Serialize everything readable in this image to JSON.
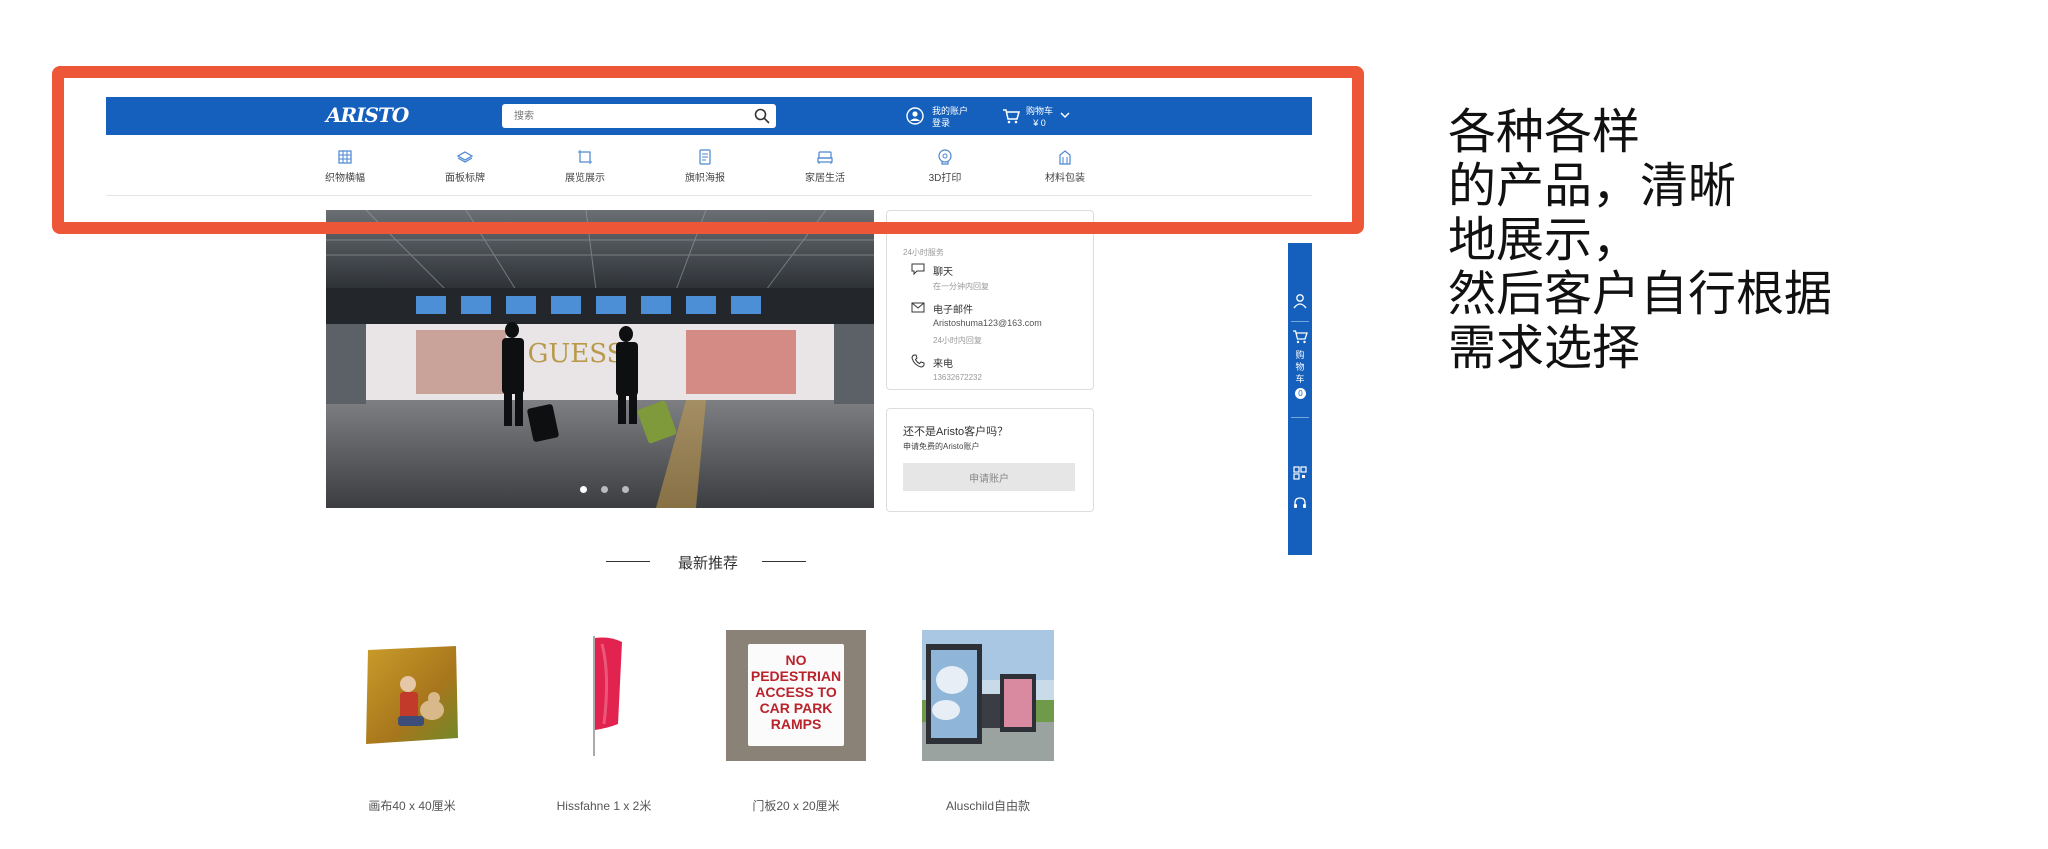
{
  "header": {
    "logo": "ARISTO",
    "search_placeholder": "搜索",
    "account_line1": "我的账户",
    "account_line2": "登录",
    "cart_line1": "购物车",
    "cart_line2": "¥ 0"
  },
  "categories": [
    {
      "label": "织物横幅",
      "icon": "fabric-icon"
    },
    {
      "label": "面板标牌",
      "icon": "panel-icon"
    },
    {
      "label": "展览展示",
      "icon": "frame-icon"
    },
    {
      "label": "旗帜海报",
      "icon": "poster-icon"
    },
    {
      "label": "家居生活",
      "icon": "bed-icon"
    },
    {
      "label": "3D打印",
      "icon": "3d-icon"
    },
    {
      "label": "材料包装",
      "icon": "package-icon"
    }
  ],
  "banner": {
    "slides": 3,
    "active_slide": 1
  },
  "contact": {
    "service_hours": "24小时服务",
    "chat_label": "聊天",
    "chat_note": "在一分钟内回复",
    "email_label": "电子邮件",
    "email_value": "Aristoshuma123@163.com",
    "email_note": "24小时内回复",
    "phone_label": "来电",
    "phone_value": "13632672232"
  },
  "signup": {
    "question": "还不是Aristo客户吗？",
    "sub": "申请免费的Aristo账户",
    "button": "申请账户"
  },
  "sidebar": {
    "cart_label_1": "购",
    "cart_label_2": "物",
    "cart_label_3": "车",
    "cart_count": "0"
  },
  "section_title": "最新推荐",
  "products": [
    {
      "name": "画布40 x 40厘米"
    },
    {
      "name": "Hissfahne 1 x 2米"
    },
    {
      "name": "门板20 x 20厘米",
      "sign_text": [
        "NO",
        "PEDESTRIAN",
        "ACCESS TO",
        "CAR PARK",
        "RAMPS"
      ]
    },
    {
      "name": "Aluschild自由款"
    }
  ],
  "note": [
    "各种各样",
    "的产品，清晰",
    "地展示，",
    "然后客户自行根据",
    "需求选择"
  ],
  "colors": {
    "brand_blue": "#1560bd",
    "highlight": "#ee5638"
  }
}
